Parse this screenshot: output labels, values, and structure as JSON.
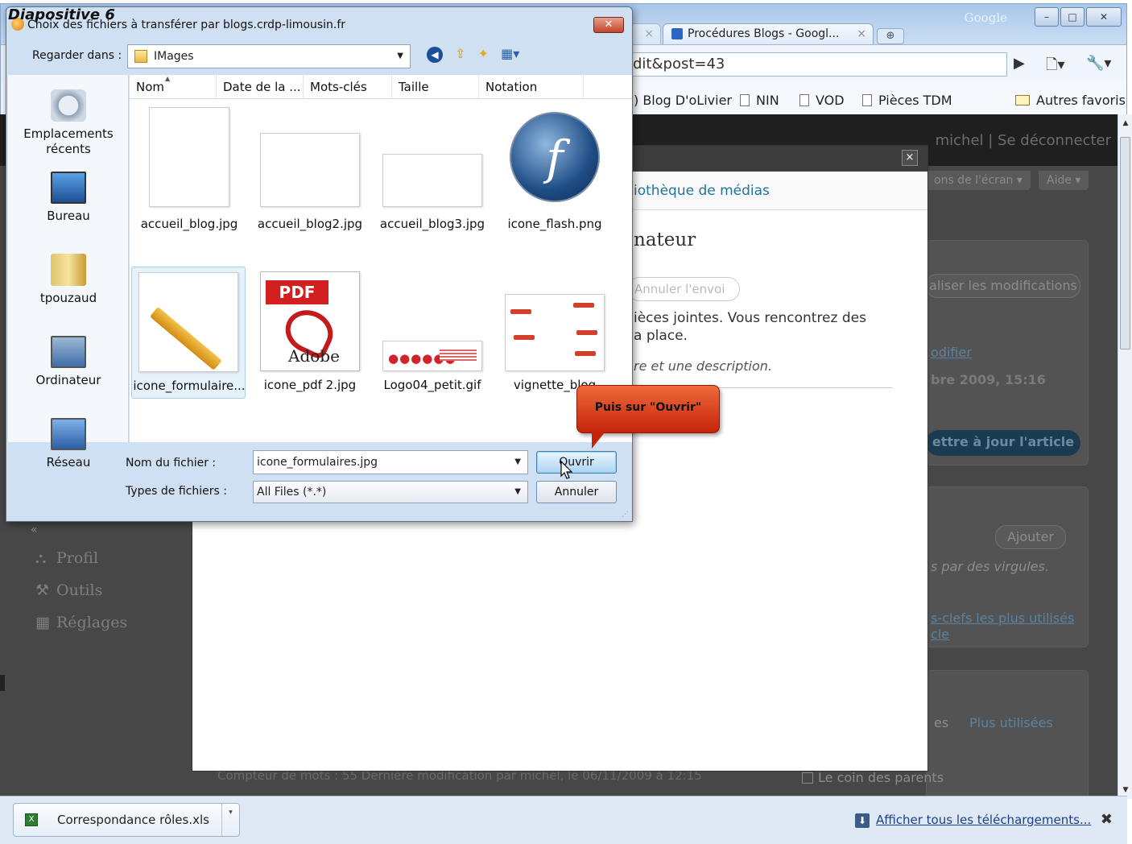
{
  "slide_label": "Diapositive 6",
  "browser": {
    "google_label": "Google",
    "tab_close": "×",
    "tab_label": "Procédures Blogs - Googl...",
    "tab_close2": "×",
    "newtab_icon": "plus-tab-icon",
    "window_buttons": [
      "–",
      "□",
      "✕"
    ],
    "url_fragment": "dit&post=43",
    "toolbar_icons": [
      "▶",
      "🗋▾",
      "🔧▾"
    ],
    "bookmarks": [
      "Blog D'oLivier",
      "NIN",
      "VOD",
      "Pièces TDM"
    ],
    "other_bookmarks": "Autres favoris"
  },
  "wp": {
    "user_text": "michel | Se déconnecter",
    "screen_options": "ons de l'écran ▾",
    "help": "Aide ▾",
    "save_changes": "aliser les modifications",
    "modify_link": "odifier",
    "date_text": "bre 2009, 15:16",
    "update_button": "ettre à jour l'article",
    "add_button": "Ajouter",
    "tags_hint": "s par des virgules.",
    "tags_link1": "s-clefs les plus utilisés",
    "tags_link2": "cle",
    "cat_tab1": "es",
    "cat_tab2": "Plus utilisées",
    "category_item": "Le coin des parents",
    "nav": [
      {
        "icon": "⛬",
        "label": "Profil"
      },
      {
        "icon": "⚒",
        "label": "Outils"
      },
      {
        "icon": "▦",
        "label": "Réglages"
      }
    ],
    "collapse": "«",
    "word_count": "Compteur de mots : 55      Dernière modification par michel, le 06/11/2009 à 12:15"
  },
  "modal": {
    "close": "×",
    "tab_label": "iothèque de médias",
    "title": "nateur",
    "cancel_upload": "Annuler l'envoi",
    "line1": "ièces jointes. Vous rencontrez des",
    "line2": "a place.",
    "line3": "re et une description."
  },
  "download_bar": {
    "file_name": "Correspondance rôles.xls",
    "show_all": "Afficher tous les téléchargements...",
    "close": "✖"
  },
  "dialog": {
    "title": "Choix des fichiers à transférer par blogs.crdp-limousin.fr",
    "close": "✕",
    "look_in_label": "Regarder dans :",
    "look_in_value": "IMages",
    "nav_icons": [
      "back-icon",
      "up-folder-icon",
      "new-folder-icon",
      "view-menu-icon"
    ],
    "places": [
      "Emplacements récents",
      "Bureau",
      "tpouzaud",
      "Ordinateur",
      "Réseau"
    ],
    "columns": [
      "Nom",
      "Date de la ...",
      "Mots-clés",
      "Taille",
      "Notation"
    ],
    "files": [
      "accueil_blog.jpg",
      "accueil_blog2.jpg",
      "accueil_blog3.jpg",
      "icone_flash.png",
      "icone_formulaire...",
      "icone_pdf 2.jpg",
      "Logo04_petit.gif",
      "vignette_blog"
    ],
    "selected_file": "icone_formulaire...",
    "file_name_label": "Nom du fichier :",
    "file_name_value": "icone_formulaires.jpg",
    "file_type_label": "Types de fichiers :",
    "file_type_value": "All Files (*.*)",
    "open_button": "Ouvrir",
    "cancel_button": "Annuler"
  },
  "callout": "Puis sur \"Ouvrir\""
}
